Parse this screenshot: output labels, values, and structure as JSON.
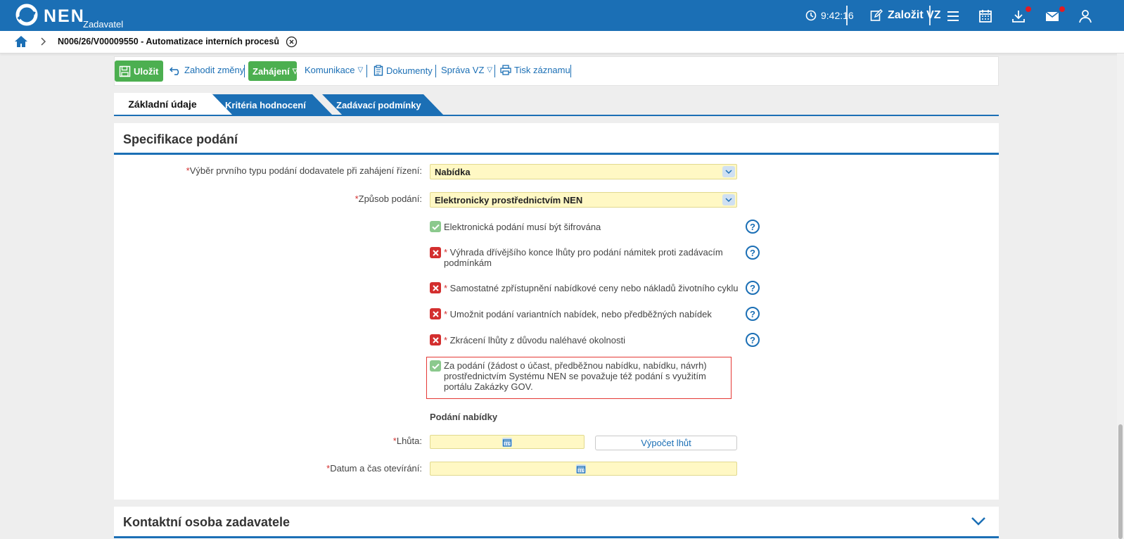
{
  "header": {
    "logo_text": "NEN",
    "logo_sub": "Zadavatel",
    "time": "9:42:16",
    "create_label": "Založit VZ"
  },
  "breadcrumb": {
    "record": "N006/26/V00009550 - Automatizace interních procesů"
  },
  "toolbar": {
    "save": "Uložit",
    "discard": "Zahodit změny",
    "start": "Zahájení",
    "communication": "Komunikace",
    "documents": "Dokumenty",
    "manage": "Správa VZ",
    "print": "Tisk záznamu"
  },
  "tabs": [
    "Základní údaje",
    "Kritéria hodnocení",
    "Zadávací podmínky"
  ],
  "section": {
    "title": "Specifikace podání",
    "fields": {
      "first_type_label": "Výběr prvního typu podání dodavatele při zahájení řízení:",
      "first_type_value": "Nabídka",
      "method_label": "Způsob podání:",
      "method_value": "Elektronicky prostřednictvím NEN"
    },
    "checks": [
      {
        "label": "Elektronická podání musí být šifrována",
        "checked": true
      },
      {
        "label": "Výhrada dřívějšího konce lhůty pro podání námitek proti zadávacím podmínkám",
        "checked": false
      },
      {
        "label": "Samostatné zpřístupnění nabídkové ceny nebo nákladů životního cyklu",
        "checked": false
      },
      {
        "label": "Umožnit podání variantních nabídek, nebo předběžných nabídek",
        "checked": false
      },
      {
        "label": "Zkrácení lhůty z důvodu naléhavé okolnosti",
        "checked": false
      },
      {
        "label": "Za podání (žádost o účast, předběžnou nabídku, nabídku, návrh) prostřednictvím Systému NEN se považuje též podání s využitím portálu Zakázky GOV.",
        "checked": true
      }
    ],
    "submission_heading": "Podání nabídky",
    "deadline_label": "Lhůta:",
    "calc_button": "Výpočet lhůt",
    "opening_label": "Datum a čas otevírání:"
  },
  "section2": {
    "title": "Kontaktní osoba zadavatele"
  },
  "colors": {
    "primary": "#1b6fb5",
    "green": "#4caf50",
    "required": "#d32f2f",
    "field_bg": "#fff8c4"
  }
}
